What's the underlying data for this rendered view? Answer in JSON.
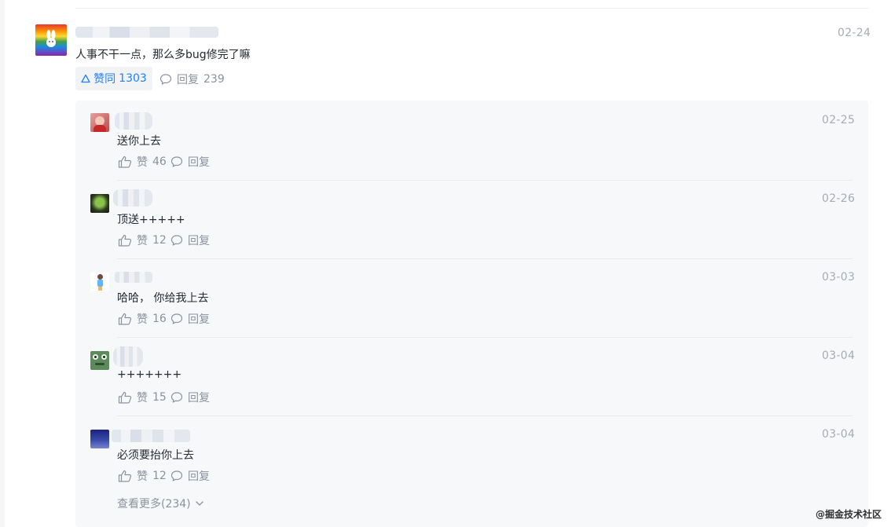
{
  "main_comment": {
    "content": "人事不干一点，那么多bug修完了嘛",
    "time": "02-24",
    "like_label": "赞同",
    "like_count": "1303",
    "reply_label": "回复",
    "reply_count": "239"
  },
  "replies": [
    {
      "content": "送你上去",
      "time": "02-25",
      "like_label": "赞",
      "like_count": "46",
      "reply_label": "回复"
    },
    {
      "content": "顶送+++++",
      "time": "02-26",
      "like_label": "赞",
      "like_count": "12",
      "reply_label": "回复"
    },
    {
      "content": "哈哈， 你给我上去",
      "time": "03-03",
      "like_label": "赞",
      "like_count": "16",
      "reply_label": "回复"
    },
    {
      "content": "+++++++",
      "time": "03-04",
      "like_label": "赞",
      "like_count": "15",
      "reply_label": "回复"
    },
    {
      "content": "必须要抬你上去",
      "time": "03-04",
      "like_label": "赞",
      "like_count": "12",
      "reply_label": "回复"
    }
  ],
  "view_more": "查看更多(234)",
  "watermark": "@掘金技术社区",
  "colors": {
    "accent": "#1e80ff",
    "muted": "#8a919f",
    "time": "#a7abb3",
    "panel": "#f7f8fa"
  }
}
